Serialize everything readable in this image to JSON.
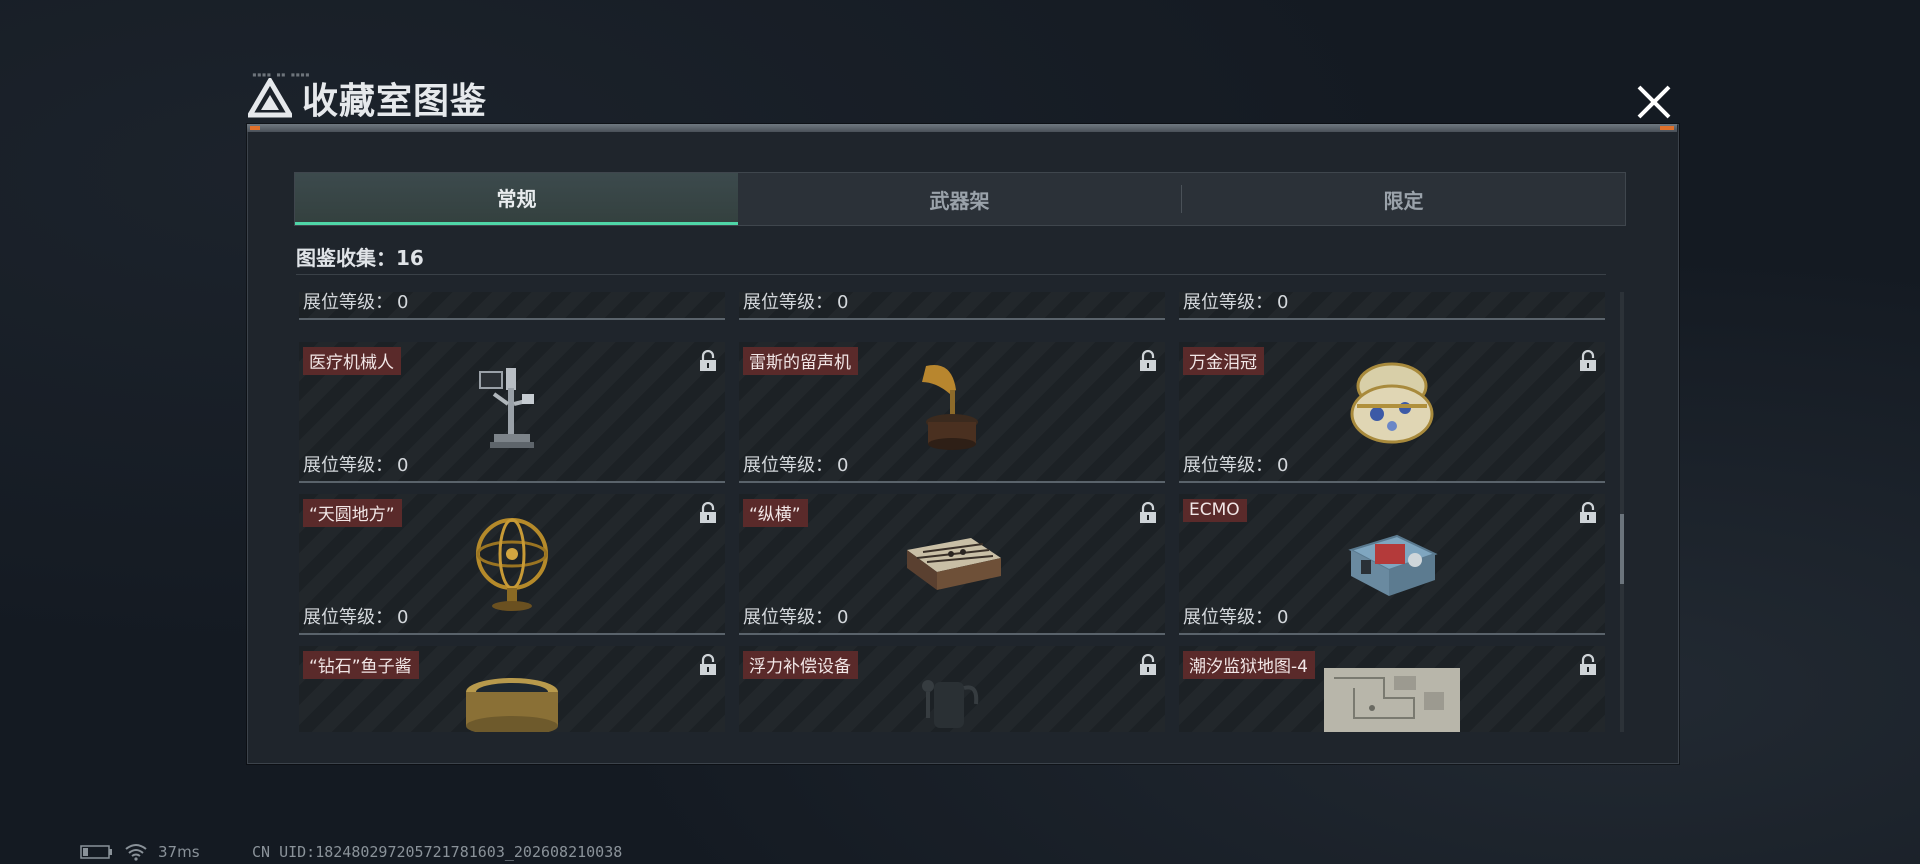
{
  "header": {
    "title": "收藏室图鉴"
  },
  "tabs": [
    {
      "label": "常规",
      "active": true
    },
    {
      "label": "武器架",
      "active": false
    },
    {
      "label": "限定",
      "active": false
    }
  ],
  "collection": {
    "label": "图鉴收集：16"
  },
  "level_label": "展位等级：",
  "cards": [
    {
      "name": "",
      "level": "0",
      "art": "partial-top-1"
    },
    {
      "name": "",
      "level": "0",
      "art": "partial-top-2"
    },
    {
      "name": "",
      "level": "0",
      "art": "partial-top-3"
    },
    {
      "name": "医疗机械人",
      "level": "0",
      "art": "medical-robot-icon",
      "locked": true
    },
    {
      "name": "雷斯的留声机",
      "level": "0",
      "art": "gramophone-icon",
      "locked": true
    },
    {
      "name": "万金泪冠",
      "level": "0",
      "art": "jeweled-egg-icon",
      "locked": true
    },
    {
      "name": "“天圆地方”",
      "level": "0",
      "art": "armillary-sphere-icon",
      "locked": true
    },
    {
      "name": "“纵横”",
      "level": "0",
      "art": "chess-box-icon",
      "locked": true
    },
    {
      "name": "ECMO",
      "level": "0",
      "art": "ecmo-machine-icon",
      "locked": true
    },
    {
      "name": "“钻石”鱼子酱",
      "level": "",
      "art": "caviar-tin-icon",
      "locked": true
    },
    {
      "name": "浮力补偿设备",
      "level": "",
      "art": "diving-device-icon",
      "locked": true
    },
    {
      "name": "潮汐监狱地图-4",
      "level": "",
      "art": "prison-map-icon",
      "locked": true
    }
  ],
  "status": {
    "ping": "37ms",
    "uid": "CN UID:18248029720572​1781603_202608210038"
  },
  "colors": {
    "accent": "#4fd6a8",
    "name_tag": "#5a2a2a",
    "orange": "#e0702a"
  }
}
